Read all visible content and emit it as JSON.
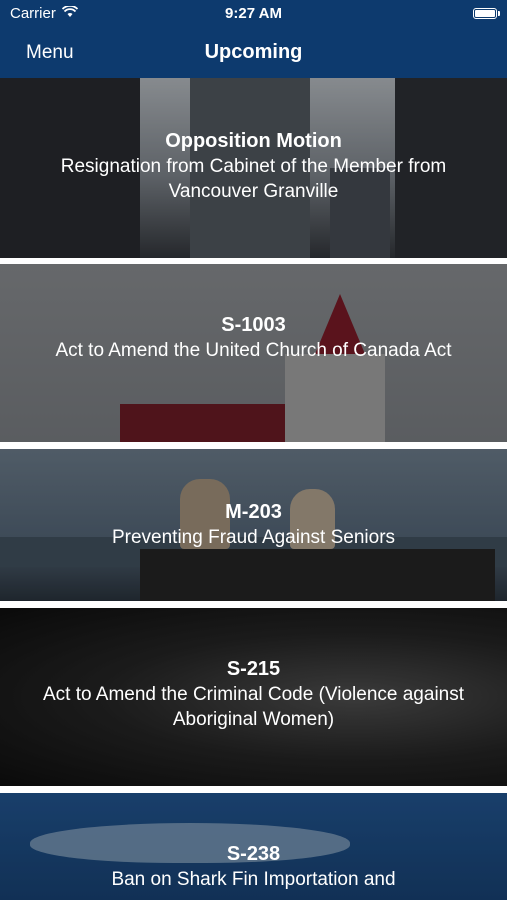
{
  "status": {
    "carrier": "Carrier",
    "time": "9:27 AM",
    "battery_level": 1.0
  },
  "nav": {
    "menu_label": "Menu",
    "title": "Upcoming"
  },
  "items": [
    {
      "title": "Opposition Motion",
      "subtitle": "Resignation from Cabinet of the Member from Vancouver Granville"
    },
    {
      "title": "S-1003",
      "subtitle": "Act to Amend the United Church of Canada Act"
    },
    {
      "title": "M-203",
      "subtitle": "Preventing Fraud Against Seniors"
    },
    {
      "title": "S-215",
      "subtitle": "Act to Amend the Criminal Code (Violence against Aboriginal Women)"
    },
    {
      "title": "S-238",
      "subtitle": "Ban on Shark Fin Importation and"
    }
  ],
  "colors": {
    "nav_background": "#0d3a6e",
    "text": "#ffffff"
  }
}
